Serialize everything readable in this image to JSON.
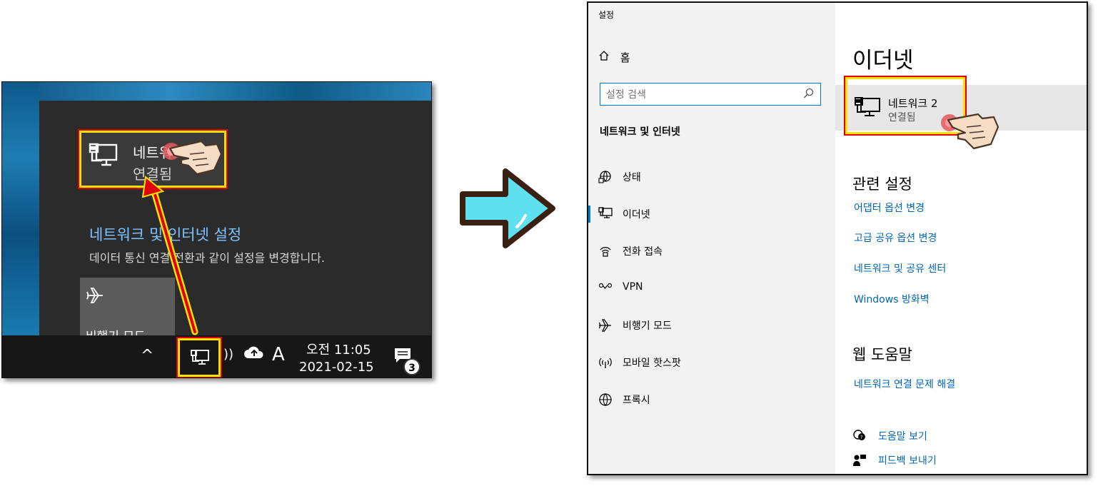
{
  "flyout": {
    "network_name": "네트워크 2",
    "network_status": "연결됨",
    "settings_title": "네트워크 및 인터넷 설정",
    "settings_desc": "데이터 통신 연결 전환과 같이 설정을 변경합니다.",
    "airplane_label": "비행기 모드"
  },
  "taskbar": {
    "chevron": "^",
    "ime": "A",
    "time": "오전 11:05",
    "date": "2021-02-15",
    "notification_count": "3"
  },
  "settings": {
    "app_title": "설정",
    "home_label": "홈",
    "search_placeholder": "설정 검색",
    "section_heading": "네트워크 및 인터넷",
    "nav": [
      {
        "label": "상태",
        "icon": "globe-status-icon"
      },
      {
        "label": "이더넷",
        "icon": "ethernet-icon",
        "active": true
      },
      {
        "label": "전화 접속",
        "icon": "dialup-icon"
      },
      {
        "label": "VPN",
        "icon": "vpn-icon"
      },
      {
        "label": "비행기 모드",
        "icon": "airplane-icon"
      },
      {
        "label": "모바일 핫스팟",
        "icon": "hotspot-icon"
      },
      {
        "label": "프록시",
        "icon": "globe-icon"
      }
    ],
    "page_title": "이더넷",
    "ethernet": {
      "name": "네트워크 2",
      "status": "연결됨"
    },
    "related_title": "관련 설정",
    "related_links": [
      "어댑터 옵션 변경",
      "고급 공유 옵션 변경",
      "네트워크 및 공유 센터",
      "Windows 방화벽"
    ],
    "web_help_title": "웹 도움말",
    "web_help_links": [
      "네트워크 연결 문제 해결"
    ],
    "help": {
      "get_help": "도움말 보기",
      "feedback": "피드백 보내기"
    }
  },
  "colors": {
    "highlight_yellow": "#ffe100",
    "highlight_red": "#e00000",
    "link_blue": "#0066b4",
    "accent": "#0078d7",
    "arrow_cyan": "#5ee0f0"
  }
}
